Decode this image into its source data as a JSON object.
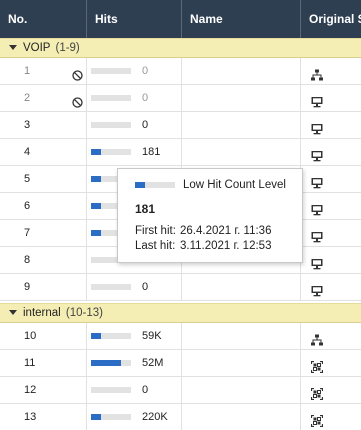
{
  "columns": {
    "no": "No.",
    "hits": "Hits",
    "name": "Name",
    "original": "Original Se"
  },
  "groups": [
    {
      "name": "VOIP",
      "range": "(1-9)"
    },
    {
      "name": "internal",
      "range": "(10-13)"
    }
  ],
  "rows": [
    {
      "no": "1",
      "hits": "0",
      "hit_fraction": 0,
      "disabled": true,
      "icon": "network-icon"
    },
    {
      "no": "2",
      "hits": "0",
      "hit_fraction": 0,
      "disabled": true,
      "icon": "monitor-icon"
    },
    {
      "no": "3",
      "hits": "0",
      "hit_fraction": 0,
      "disabled": false,
      "icon": "monitor-icon"
    },
    {
      "no": "4",
      "hits": "181",
      "hit_fraction": 0.25,
      "disabled": false,
      "icon": "monitor-icon"
    },
    {
      "no": "5",
      "hits": "",
      "hit_fraction": 0.25,
      "disabled": false,
      "icon": "monitor-icon"
    },
    {
      "no": "6",
      "hits": "",
      "hit_fraction": 0.25,
      "disabled": false,
      "icon": "monitor-icon"
    },
    {
      "no": "7",
      "hits": "",
      "hit_fraction": 0.25,
      "disabled": false,
      "icon": "monitor-icon"
    },
    {
      "no": "8",
      "hits": "",
      "hit_fraction": 0,
      "disabled": false,
      "icon": "monitor-icon"
    },
    {
      "no": "9",
      "hits": "0",
      "hit_fraction": 0,
      "disabled": false,
      "icon": "monitor-icon"
    },
    {
      "no": "10",
      "hits": "59K",
      "hit_fraction": 0.25,
      "disabled": false,
      "icon": "network-icon"
    },
    {
      "no": "11",
      "hits": "52M",
      "hit_fraction": 0.75,
      "disabled": false,
      "icon": "address-range-icon"
    },
    {
      "no": "12",
      "hits": "0",
      "hit_fraction": 0,
      "disabled": false,
      "icon": "address-range-icon"
    },
    {
      "no": "13",
      "hits": "220K",
      "hit_fraction": 0.25,
      "disabled": false,
      "icon": "address-range-icon"
    }
  ],
  "tooltip": {
    "level": "Low Hit Count Level",
    "hits": "181",
    "first_label": "First hit:",
    "first_value": "26.4.2021 г. 11:36",
    "last_label": "Last hit:",
    "last_value": "3.11.2021 г. 12:53",
    "hit_fraction": 0.25
  },
  "colors": {
    "header_bg": "#2f3f52",
    "group_bg": "#f5eeb4",
    "bar_fill": "#2b6cc4",
    "bar_empty": "#e2e2e2"
  }
}
